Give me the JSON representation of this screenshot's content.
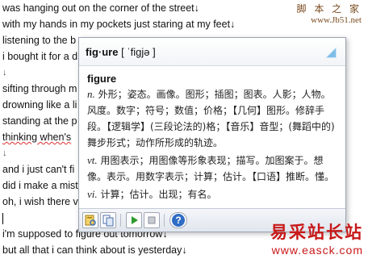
{
  "document": {
    "lines": [
      {
        "text": "was hanging out on the corner of the street↓",
        "squiggle": false
      },
      {
        "text": "with my hands in my pockets just staring at my feet↓",
        "squiggle": false
      },
      {
        "text": "listening to the b",
        "squiggle": false
      },
      {
        "text": "i bought it for a d",
        "squiggle": false
      },
      {
        "text": "↓",
        "squiggle": false,
        "para": true
      },
      {
        "text": "sifting through m",
        "squiggle": false
      },
      {
        "text": "drowning like a li",
        "squiggle": false
      },
      {
        "text": "standing at the p",
        "squiggle": false
      },
      {
        "text": "thinking when's",
        "squiggle": true
      },
      {
        "text": "↓",
        "squiggle": false,
        "para": true
      },
      {
        "text": "and i just can't fi",
        "squiggle": false
      },
      {
        "text": "did i make a mist",
        "squiggle": false
      },
      {
        "text": "oh, i wish there v",
        "squiggle": false
      },
      {
        "text": "",
        "cursor": true
      },
      {
        "text": "i'm supposed to figure out tomorrow↓",
        "squiggle": false
      },
      {
        "text": "but all that i can think about is yesterday↓",
        "squiggle": false
      }
    ]
  },
  "watermark_top": {
    "zh": "脚 本 之 家",
    "url": "www.Jb51.net"
  },
  "watermark_bottom": {
    "zh": "易采站长站",
    "url": "www.easck.com"
  },
  "popup": {
    "headword": "fig·ure",
    "phonetic": "[ ˈfiɡjə ]",
    "entry_word": "figure",
    "definitions": [
      {
        "pos": "n.",
        "text": "外形；姿态。画像。图形；插图；图表。人影；人物。风度。数字；符号；数值；价格；【几何】图形。修辞手段。【逻辑学】(三段论法的)格；【音乐】音型；(舞蹈中的)舞步形式；动作所形成的轨迹。"
      },
      {
        "pos": "vt.",
        "text": "用图表示；用图像等形象表现；描写。加图案于。想像。表示。用数字表示；计算；估计。【口语】推断。懂。"
      },
      {
        "pos": "vi.",
        "text": "计算；估计。出现；有名。"
      }
    ]
  }
}
